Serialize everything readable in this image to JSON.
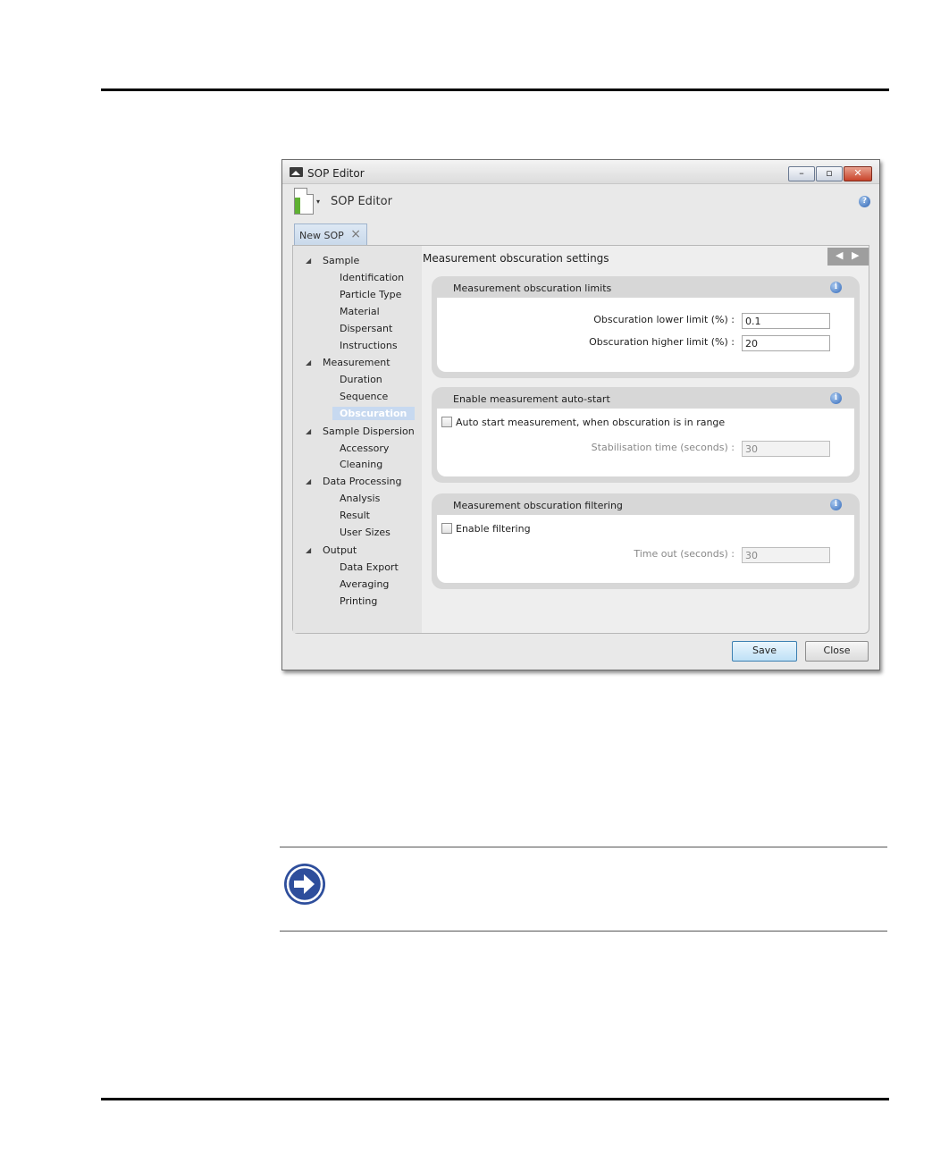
{
  "window": {
    "title": "SOP Editor",
    "controls": {
      "minimize": "–",
      "maximize": "▫",
      "close": "✕"
    }
  },
  "toolbar": {
    "title": "SOP Editor",
    "dropdown_glyph": "▾",
    "help_glyph": "?"
  },
  "tab": {
    "label": "New SOP",
    "close_glyph": "×"
  },
  "nav": {
    "items": [
      {
        "label": "Sample",
        "level": 0
      },
      {
        "label": "Identification",
        "level": 1
      },
      {
        "label": "Particle Type",
        "level": 1
      },
      {
        "label": "Material",
        "level": 1
      },
      {
        "label": "Dispersant",
        "level": 1
      },
      {
        "label": "Instructions",
        "level": 1
      },
      {
        "label": "Measurement",
        "level": 0
      },
      {
        "label": "Duration",
        "level": 1
      },
      {
        "label": "Sequence",
        "level": 1
      },
      {
        "label": "Obscuration",
        "level": 1,
        "selected": true
      },
      {
        "label": "Sample Dispersion",
        "level": 0
      },
      {
        "label": "Accessory",
        "level": 1
      },
      {
        "label": "Cleaning",
        "level": 1
      },
      {
        "label": "Data Processing",
        "level": 0
      },
      {
        "label": "Analysis",
        "level": 1
      },
      {
        "label": "Result",
        "level": 1
      },
      {
        "label": "User Sizes",
        "level": 1
      },
      {
        "label": "Output",
        "level": 0
      },
      {
        "label": "Data Export",
        "level": 1
      },
      {
        "label": "Averaging",
        "level": 1
      },
      {
        "label": "Printing",
        "level": 1
      }
    ],
    "expand_glyph": "◢",
    "prev_glyph": "◀",
    "next_glyph": "▶"
  },
  "main": {
    "section_title": "Measurement obscuration settings",
    "limits": {
      "title": "Measurement obscuration limits",
      "lower_label": "Obscuration lower limit (%) :",
      "lower_value": "0.1",
      "higher_label": "Obscuration higher limit (%) :",
      "higher_value": "20"
    },
    "autostart": {
      "title": "Enable measurement auto-start",
      "checkbox_label": "Auto start measurement, when obscuration is in range",
      "checked": false,
      "stab_label": "Stabilisation time (seconds) :",
      "stab_value": "30"
    },
    "filtering": {
      "title": "Measurement obscuration filtering",
      "checkbox_label": "Enable filtering",
      "checked": false,
      "timeout_label": "Time out (seconds) :",
      "timeout_value": "30"
    },
    "info_glyph": "i"
  },
  "footer": {
    "save": "Save",
    "close": "Close"
  },
  "colors": {
    "accent": "#3269b9",
    "selection": "#c7d9f0",
    "note_icon": "#2e4e9c"
  }
}
